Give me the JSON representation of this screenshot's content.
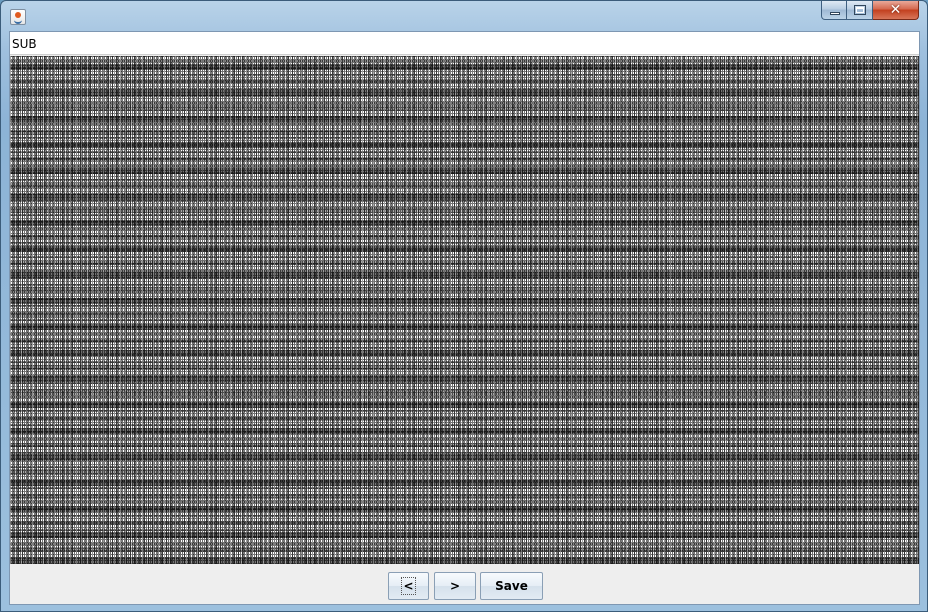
{
  "window": {
    "title": "",
    "icon": "java-cup-icon",
    "controls": [
      "minimize-icon",
      "maximize-icon",
      "close-icon"
    ]
  },
  "panel": {
    "label": "SUB"
  },
  "buttons": {
    "prev_label": "<",
    "next_label": ">",
    "save_label": "Save"
  }
}
